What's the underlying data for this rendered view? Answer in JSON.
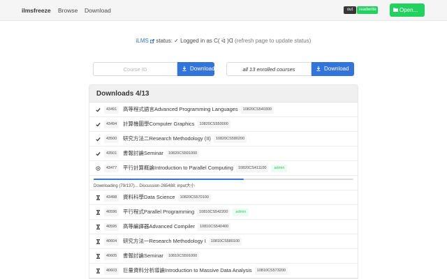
{
  "navbar": {
    "brand": "ilmsfreeze",
    "links": [
      "Browse",
      "Download"
    ],
    "toggle_out": "out",
    "toggle_readwrite": "readwrite",
    "open_label": "Open..."
  },
  "status": {
    "ilms_label": "iLMS",
    "status_label": "status:",
    "logged_in": "✓ Logged in as C( ᐛ )Ɑ",
    "refresh_hint": "(refresh page to update status)"
  },
  "download_bar": {
    "course_id_placeholder": "Course ID",
    "download_label": "Download",
    "all_courses_value": "all 13 enrolled courses",
    "download_all_label": "Download"
  },
  "downloads": {
    "title": "Downloads 4/13",
    "items": [
      {
        "status": "done",
        "id": "43491",
        "name": "高等程式語言Advanced Programming Languages",
        "code": "10820CS540300",
        "admin": ""
      },
      {
        "status": "done",
        "id": "43494",
        "name": "計算機圖學Computer Graphics",
        "code": "10820CS550000",
        "admin": ""
      },
      {
        "status": "done",
        "id": "43500",
        "name": "研究方法二Research Methodology (II)",
        "code": "10820CS580200",
        "admin": ""
      },
      {
        "status": "done",
        "id": "43501",
        "name": "書報討論Seminar",
        "code": "10820CS591000",
        "admin": ""
      },
      {
        "status": "in-progress",
        "id": "43477",
        "name": "平行計算概論Introduction to Parallel Computing",
        "code": "10820CS411100",
        "admin": "admin"
      },
      {
        "status": "pending",
        "id": "43498",
        "name": "資料科學Data Science",
        "code": "10820CS570100",
        "admin": ""
      },
      {
        "status": "pending",
        "id": "40596",
        "name": "平行程式Parallel Programming",
        "code": "10810CS542200",
        "admin": "admin"
      },
      {
        "status": "pending",
        "id": "40595",
        "name": "高等編譯器Advanced Compiler",
        "code": "10810CS540400",
        "admin": ""
      },
      {
        "status": "pending",
        "id": "40604",
        "name": "研究方法一Research Methodology I",
        "code": "10810CS580100",
        "admin": ""
      },
      {
        "status": "pending",
        "id": "40605",
        "name": "書報討論Seminar",
        "code": "10810CS591000",
        "admin": ""
      },
      {
        "status": "pending",
        "id": "40603",
        "name": "巨量資料分析導論Introduction to Massive Data Analysis",
        "code": "10810CS573200",
        "admin": ""
      }
    ],
    "progress": {
      "text": "Downloading (79/137)... Discussion-265488: input大小",
      "done": 79,
      "total": 137
    }
  },
  "colors": {
    "primary": "#3273dc",
    "success": "#23d160",
    "dark": "#363636"
  }
}
